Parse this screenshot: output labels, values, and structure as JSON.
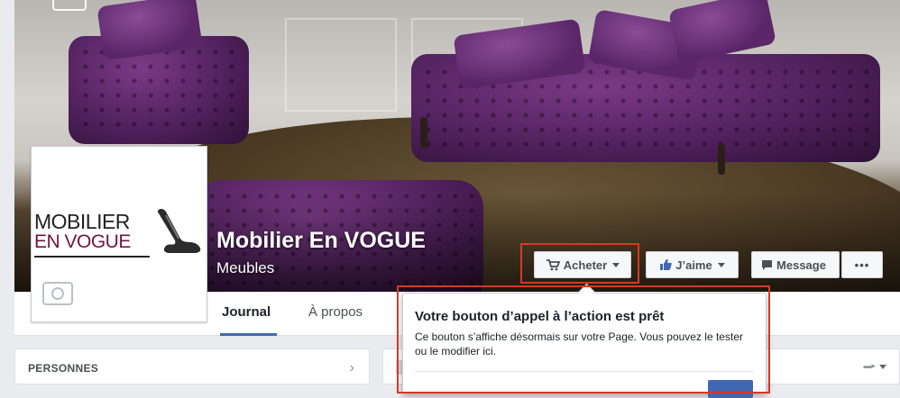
{
  "page": {
    "name": "Mobilier En VOGUE",
    "category": "Meubles"
  },
  "logo": {
    "line1": "MOBILIER",
    "line2": "EN VOGUE"
  },
  "actions": {
    "acheter": "Acheter",
    "jaime": "J’aime",
    "message": "Message",
    "more": "•••"
  },
  "tabs": [
    {
      "label": "Journal",
      "active": true
    },
    {
      "label": "À propos",
      "active": false
    }
  ],
  "left_card": {
    "title": "PERSONNES",
    "chevron": "›"
  },
  "popover": {
    "title": "Votre bouton d’appel à l’action est prêt",
    "body": "Ce bouton s’affiche désormais sur votre Page. Vous pouvez le tester ou le modifier ici."
  },
  "colors": {
    "highlight": "#d63a24",
    "facebook_blue": "#4267b2",
    "logo_maroon": "#6e1745"
  },
  "icons": [
    "camera-icon",
    "cart-icon",
    "thumbs-up-icon",
    "message-icon",
    "chair-logo-icon"
  ]
}
